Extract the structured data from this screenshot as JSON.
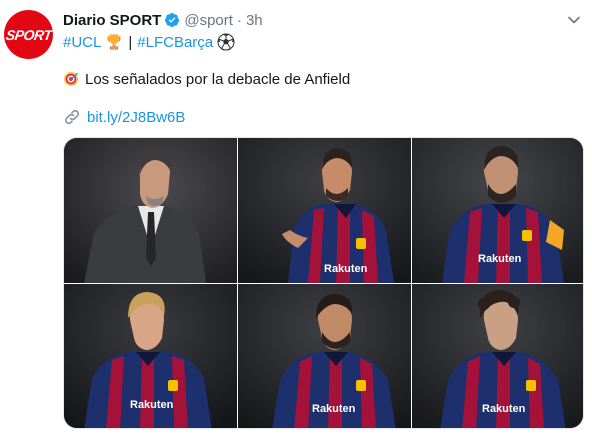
{
  "account": {
    "name": "Diario SPORT",
    "handle": "@sport",
    "separator": "·",
    "time": "3h",
    "avatar_text": "SPORT"
  },
  "hashtags": {
    "tag1": "#UCL",
    "separator": "|",
    "tag2": "#LFCBarça"
  },
  "tweet_text": "Los señalados por la debacle de Anfield",
  "link_text": "bit.ly/2J8Bw6B",
  "colors": {
    "brand_red": "#e30613",
    "link_blue": "#1b95e0",
    "secondary_grey": "#657786",
    "barca_blue": "#1e2f6e",
    "barca_red": "#a4123a"
  },
  "icons": {
    "verified": "verified-badge-icon",
    "caret": "chevron-down-icon",
    "trophy": "trophy-icon",
    "ball": "soccer-ball-icon",
    "target": "target-icon",
    "link": "link-icon"
  },
  "media": {
    "photos": [
      {
        "subject": "coach-suit"
      },
      {
        "subject": "player-pointing"
      },
      {
        "subject": "player-captain"
      },
      {
        "subject": "player-blond"
      },
      {
        "subject": "player-running"
      },
      {
        "subject": "player-curly"
      }
    ]
  }
}
